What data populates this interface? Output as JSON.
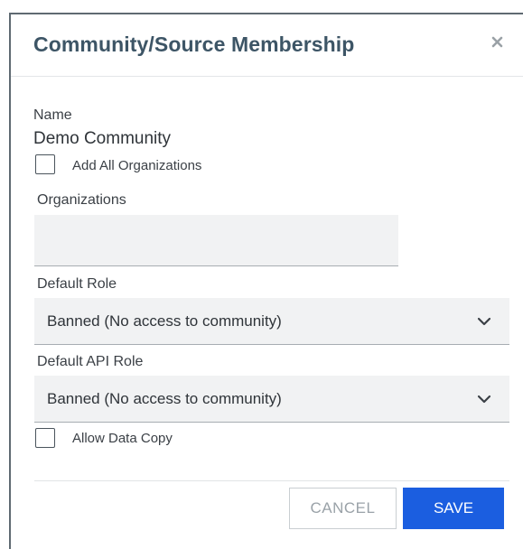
{
  "dialog": {
    "title": "Community/Source Membership",
    "close_icon": "close-icon"
  },
  "form": {
    "name_label": "Name",
    "name_value": "Demo Community",
    "add_all_orgs_label": "Add All Organizations",
    "add_all_orgs_checked": false,
    "organizations_label": "Organizations",
    "organizations_value": "",
    "default_role_label": "Default Role",
    "default_role_value": "Banned (No access to community)",
    "default_api_role_label": "Default API Role",
    "default_api_role_value": "Banned (No access to community)",
    "allow_data_copy_label": "Allow Data Copy",
    "allow_data_copy_checked": false
  },
  "actions": {
    "cancel_label": "CANCEL",
    "save_label": "SAVE"
  },
  "colors": {
    "title": "#3d5566",
    "primary": "#1b5ee0",
    "field_bg": "#f1f2f3"
  }
}
